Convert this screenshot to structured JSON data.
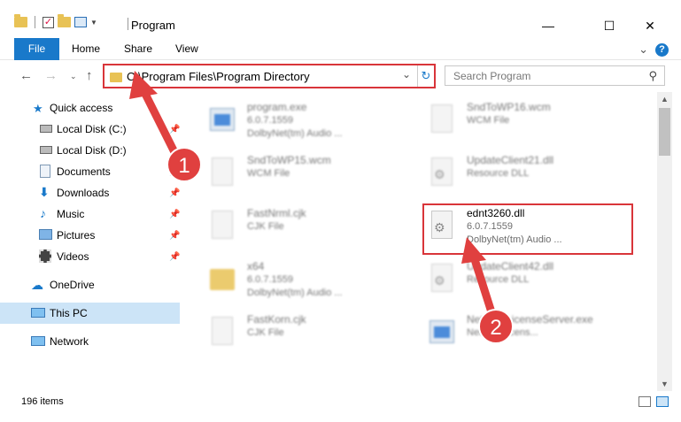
{
  "window": {
    "title": "Program",
    "minimize": "—",
    "maximize": "☐",
    "close": "✕"
  },
  "ribbon": {
    "tabs": [
      "File",
      "Home",
      "Share",
      "View"
    ],
    "expand": "⌄",
    "help": "?"
  },
  "address": {
    "path": "C:\\Program Files\\Program Directory",
    "search_placeholder": "Search Program"
  },
  "sidebar": {
    "items": [
      {
        "label": "Quick access",
        "icon": "star-icon",
        "pinned": false
      },
      {
        "label": "Local Disk (C:)",
        "icon": "drive-icon",
        "pinned": true
      },
      {
        "label": "Local Disk (D:)",
        "icon": "drive-icon",
        "pinned": false
      },
      {
        "label": "Documents",
        "icon": "documents-icon",
        "pinned": true
      },
      {
        "label": "Downloads",
        "icon": "download-icon",
        "pinned": true
      },
      {
        "label": "Music",
        "icon": "music-icon",
        "pinned": true
      },
      {
        "label": "Pictures",
        "icon": "pictures-icon",
        "pinned": true
      },
      {
        "label": "Videos",
        "icon": "videos-icon",
        "pinned": true
      },
      {
        "label": "OneDrive",
        "icon": "cloud-icon",
        "pinned": false
      },
      {
        "label": "This PC",
        "icon": "computer-icon",
        "pinned": false,
        "selected": true
      },
      {
        "label": "Network",
        "icon": "network-icon",
        "pinned": false
      }
    ]
  },
  "files": [
    {
      "name": "program.exe",
      "line1": "6.0.7.1559",
      "line2": "DolbyNet(tm) Audio ...",
      "icon": "installer-icon"
    },
    {
      "name": "SndToWP16.wcm",
      "line1": "WCM File",
      "line2": "",
      "icon": "document-icon"
    },
    {
      "name": "SndToWP15.wcm",
      "line1": "WCM File",
      "line2": "",
      "icon": "document-icon"
    },
    {
      "name": "UpdateClient21.dll",
      "line1": "Resource DLL",
      "line2": "",
      "icon": "dll-gear-icon"
    },
    {
      "name": "FastNrml.cjk",
      "line1": "CJK File",
      "line2": "",
      "icon": "document-icon"
    },
    {
      "name": "ednt3260.dll",
      "line1": "6.0.7.1559",
      "line2": "DolbyNet(tm) Audio ...",
      "icon": "dll-gear-icon",
      "highlighted": true
    },
    {
      "name": "x64",
      "line1": "6.0.7.1559",
      "line2": "DolbyNet(tm) Audio ...",
      "icon": "folder-icon"
    },
    {
      "name": "UpdateClient42.dll",
      "line1": "Resource DLL",
      "line2": "",
      "icon": "dll-gear-icon"
    },
    {
      "name": "FastKorn.cjk",
      "line1": "CJK File",
      "line2": "",
      "icon": "document-icon"
    },
    {
      "name": "NetworkLicenseServer.exe",
      "line1": "Network licens...",
      "line2": "",
      "icon": "exe-icon"
    }
  ],
  "status": {
    "item_count": "196 items"
  },
  "annotations": {
    "step1": "1",
    "step2": "2",
    "color": "#d9353a"
  }
}
